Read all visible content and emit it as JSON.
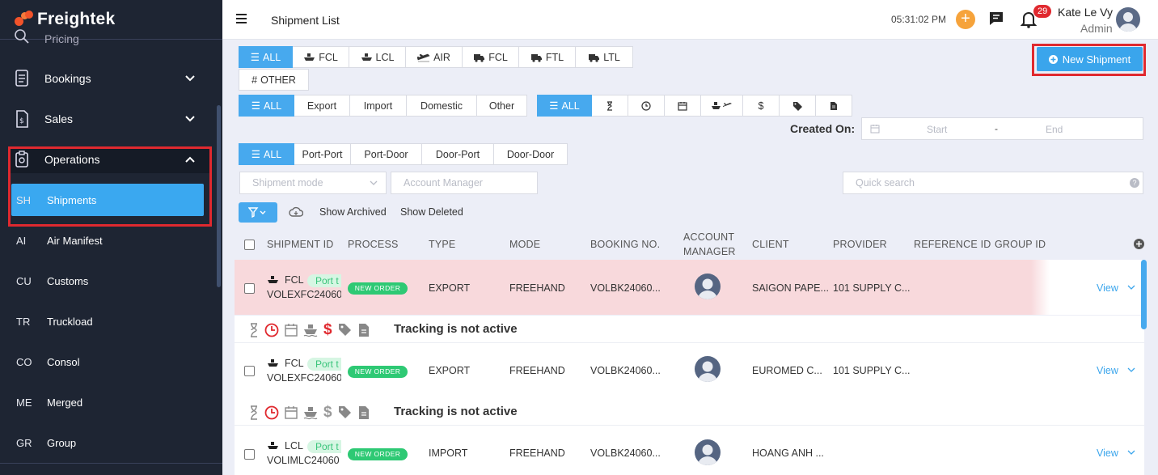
{
  "app": {
    "brand": "Freightek",
    "brand_color": "#f2532a",
    "accent": "#47a9ee"
  },
  "sidebar": {
    "partial_item": "Pricing",
    "items": [
      {
        "label": "Bookings",
        "icon": "bookings-icon"
      },
      {
        "label": "Sales",
        "icon": "sales-icon"
      },
      {
        "label": "Operations",
        "icon": "operations-icon",
        "expanded": true
      }
    ],
    "subitems": [
      {
        "abbr": "SH",
        "label": "Shipments",
        "active": true
      },
      {
        "abbr": "AI",
        "label": "Air Manifest"
      },
      {
        "abbr": "CU",
        "label": "Customs"
      },
      {
        "abbr": "TR",
        "label": "Truckload"
      },
      {
        "abbr": "CO",
        "label": "Consol"
      },
      {
        "abbr": "ME",
        "label": "Merged"
      },
      {
        "abbr": "GR",
        "label": "Group"
      }
    ]
  },
  "header": {
    "title": "Shipment List",
    "time": "05:31:02 PM",
    "notifications": "29",
    "user_name": "Kate Le Vy",
    "user_role": "Admin"
  },
  "filters": {
    "mode_tabs": [
      "ALL",
      "FCL",
      "LCL",
      "AIR",
      "FCL",
      "FTL",
      "LTL",
      "OTHER"
    ],
    "direction_tabs": [
      "ALL",
      "Export",
      "Import",
      "Domestic",
      "Other"
    ],
    "status_all": "ALL",
    "route_tabs": [
      "ALL",
      "Port-Port",
      "Port-Door",
      "Door-Port",
      "Door-Door"
    ],
    "created_on_label": "Created On:",
    "date_start": "Start",
    "date_sep": "-",
    "date_end": "End",
    "shipment_mode_placeholder": "Shipment mode",
    "account_manager_placeholder": "Account Manager",
    "quick_search_placeholder": "Quick search",
    "show_archived": "Show Archived",
    "show_deleted": "Show Deleted",
    "new_shipment": "New Shipment"
  },
  "table": {
    "headers": [
      "SHIPMENT ID",
      "PROCESS",
      "TYPE",
      "MODE",
      "BOOKING NO.",
      "ACCOUNT",
      "MANAGER",
      "CLIENT",
      "PROVIDER",
      "REFERENCE ID",
      "GROUP ID"
    ],
    "rows": [
      {
        "mode": "FCL",
        "port": "Port t",
        "id": "VOLEXFC24060",
        "process": "NEW ORDER",
        "type": "EXPORT",
        "freight": "FREEHAND",
        "booking": "VOLBK24060...",
        "client": "SAIGON PAPE...",
        "provider": "101 SUPPLY C...",
        "view": "View",
        "highlight": true
      },
      {
        "mode": "FCL",
        "port": "Port t",
        "id": "VOLEXFC24060",
        "process": "NEW ORDER",
        "type": "EXPORT",
        "freight": "FREEHAND",
        "booking": "VOLBK24060...",
        "client": "EUROMED C...",
        "provider": "101 SUPPLY C...",
        "view": "View",
        "highlight": false
      },
      {
        "mode": "LCL",
        "port": "Port t",
        "id": "VOLIMLC24060",
        "process": "NEW ORDER",
        "type": "IMPORT",
        "freight": "FREEHAND",
        "booking": "VOLBK24060...",
        "client": "HOANG ANH ...",
        "provider": "",
        "view": "View",
        "highlight": false
      }
    ],
    "tracking_text": "Tracking is not active"
  }
}
